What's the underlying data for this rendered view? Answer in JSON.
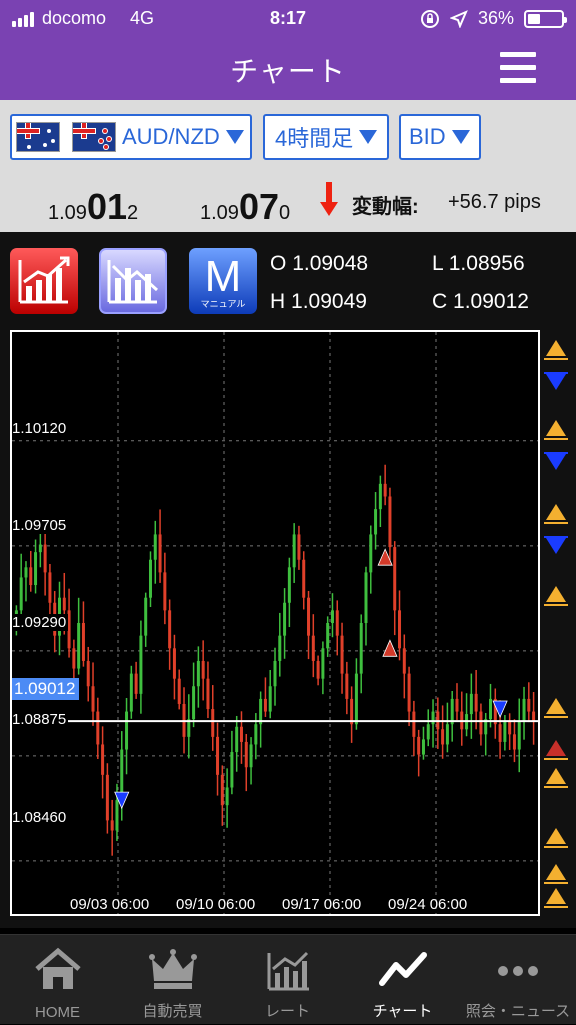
{
  "status": {
    "carrier": "docomo",
    "network": "4G",
    "time": "8:17",
    "battery": "36%",
    "battery_level": 0.36
  },
  "header": {
    "title": "チャート"
  },
  "selectors": {
    "pair": "AUD/NZD",
    "timeframe": "4時間足",
    "price_type": "BID"
  },
  "quote": {
    "bid_prefix": "1.09",
    "bid_big": "01",
    "bid_small": "2",
    "ask_prefix": "1.09",
    "ask_big": "07",
    "ask_small": "0",
    "change_label": "変動幅:",
    "change_value": "+56.7  pips"
  },
  "tools": {
    "manual_letter": "M",
    "manual_sub": "マニュアル"
  },
  "ohlc": {
    "o_label": "O",
    "o_value": "1.09048",
    "h_label": "H",
    "h_value": "1.09049",
    "l_label": "L",
    "l_value": "1.08956",
    "c_label": "C",
    "c_value": "1.09012"
  },
  "chart_data": {
    "type": "candlestick",
    "ylim": [
      1.0825,
      1.1055
    ],
    "y_ticks": [
      "1.10120",
      "1.09705",
      "1.09290",
      "1.08875",
      "1.08460"
    ],
    "x_ticks": [
      "09/03 06:00",
      "09/10 06:00",
      "09/17 06:00",
      "09/24 06:00"
    ],
    "current_price": "1.09012",
    "up_color": "#3fbf3f",
    "down_color": "#e0402a",
    "closes": [
      1.0945,
      1.0958,
      1.0962,
      1.0955,
      1.0968,
      1.0971,
      1.096,
      1.0948,
      1.0935,
      1.095,
      1.0945,
      1.093,
      1.0922,
      1.094,
      1.0925,
      1.0915,
      1.0905,
      1.0892,
      1.088,
      1.0862,
      1.0858,
      1.087,
      1.089,
      1.0905,
      1.092,
      1.0912,
      1.0935,
      1.095,
      1.0965,
      1.0975,
      1.096,
      1.0945,
      1.093,
      1.0918,
      1.0908,
      1.0895,
      1.0902,
      1.0915,
      1.0925,
      1.0918,
      1.0906,
      1.0895,
      1.088,
      1.0868,
      1.0875,
      1.0889,
      1.0899,
      1.0893,
      1.0883,
      1.0892,
      1.09,
      1.091,
      1.0905,
      1.0915,
      1.0925,
      1.0935,
      1.0948,
      1.0962,
      1.0975,
      1.0965,
      1.095,
      1.0935,
      1.0925,
      1.0918,
      1.093,
      1.094,
      1.0945,
      1.0935,
      1.092,
      1.091,
      1.09,
      1.092,
      1.094,
      1.096,
      1.0975,
      1.0985,
      1.0995,
      1.099,
      1.097,
      1.0945,
      1.093,
      1.092,
      1.0905,
      1.0895,
      1.0888,
      1.0894,
      1.09,
      1.0905,
      1.0898,
      1.0892,
      1.09,
      1.091,
      1.0905,
      1.0898,
      1.0904,
      1.0912,
      1.0905,
      1.0896,
      1.0902,
      1.091,
      1.09,
      1.0893,
      1.0901,
      1.0896,
      1.089,
      1.0901,
      1.091,
      1.0905,
      1.0901
    ],
    "signals": [
      {
        "idx": 22,
        "price": 1.087,
        "dir": "sell"
      },
      {
        "idx": 77,
        "price": 1.0966,
        "dir": "buy"
      },
      {
        "idx": 78,
        "price": 1.093,
        "dir": "buy"
      },
      {
        "idx": 101,
        "price": 1.0906,
        "dir": "sell"
      }
    ]
  },
  "side_markers": [
    "up-orange",
    "down-blue",
    "up-orange",
    "down-blue",
    "up-orange",
    "down-blue",
    "up-orange",
    "up-orange",
    "up-red",
    "up-orange",
    "up-orange",
    "up-orange",
    "up-orange"
  ],
  "tabs": [
    {
      "label": "HOME",
      "icon": "home-icon"
    },
    {
      "label": "自動売買",
      "icon": "crown-icon"
    },
    {
      "label": "レート",
      "icon": "rate-chart-icon"
    },
    {
      "label": "チャート",
      "icon": "chart-line-icon"
    },
    {
      "label": "照会・ニュース",
      "icon": "more-dots-icon"
    }
  ]
}
